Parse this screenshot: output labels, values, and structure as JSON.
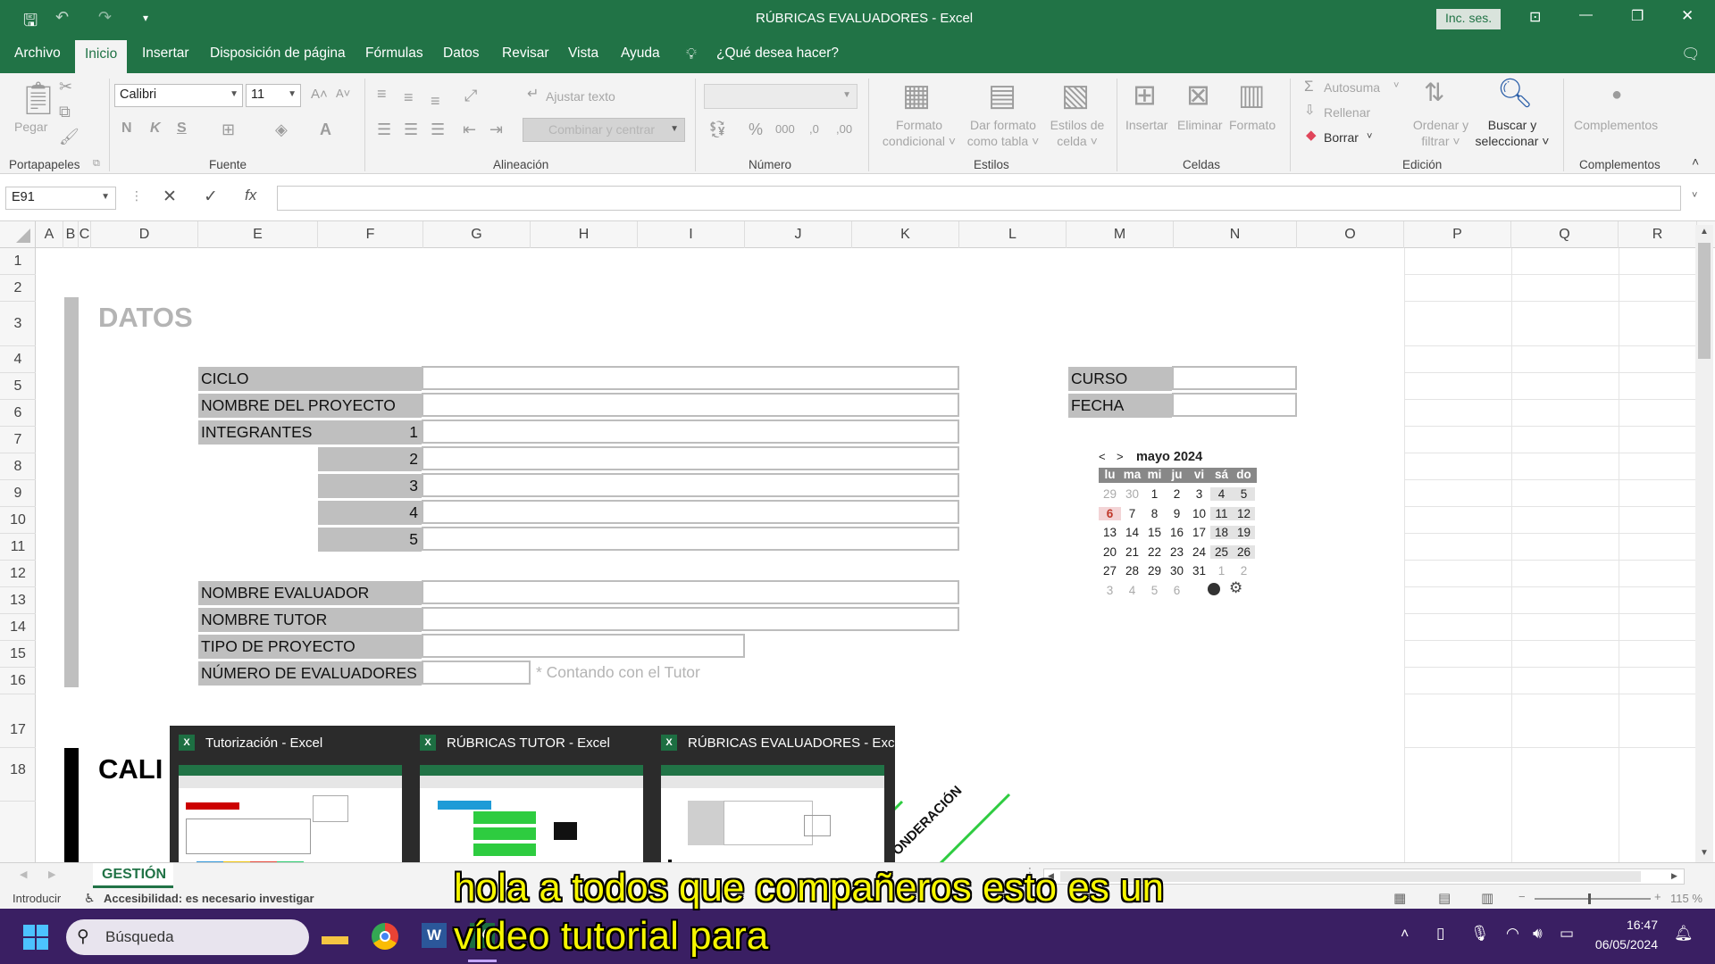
{
  "window": {
    "title": "RÚBRICAS EVALUADORES  -  Excel",
    "signin_label": "Inc. ses.",
    "minimize_glyph": "—",
    "restore_glyph": "❐",
    "close_glyph": "✕"
  },
  "menu": {
    "tabs": [
      "Archivo",
      "Inicio",
      "Insertar",
      "Disposición de página",
      "Fórmulas",
      "Datos",
      "Revisar",
      "Vista",
      "Ayuda"
    ],
    "active": "Inicio",
    "tell_me": "¿Qué desea hacer?"
  },
  "ribbon": {
    "clipboard": {
      "paste": "Pegar",
      "label": "Portapapeles"
    },
    "font": {
      "name": "Calibri",
      "size": "11",
      "bold": "N",
      "italic": "K",
      "underline": "S",
      "label": "Fuente"
    },
    "alignment": {
      "wrap": "Ajustar texto",
      "merge": "Combinar y centrar",
      "label": "Alineación"
    },
    "number": {
      "label": "Número",
      "percent": "%",
      "thousands": "000"
    },
    "styles": {
      "conditional": [
        "Formato",
        "condicional"
      ],
      "table": [
        "Dar formato",
        "como tabla"
      ],
      "cell": [
        "Estilos de",
        "celda"
      ],
      "label": "Estilos"
    },
    "cells": {
      "insert": "Insertar",
      "delete": "Eliminar",
      "format": "Formato",
      "label": "Celdas"
    },
    "editing": {
      "autosum": "Autosuma",
      "fill": "Rellenar",
      "clear": "Borrar",
      "sort": [
        "Ordenar y",
        "filtrar"
      ],
      "find": [
        "Buscar y",
        "seleccionar"
      ],
      "label": "Edición"
    },
    "addins": {
      "button": "Complementos",
      "label": "Complementos"
    }
  },
  "formula_bar": {
    "name_box": "E91",
    "fx": "fx",
    "value": ""
  },
  "columns": [
    "A",
    "B",
    "C",
    "D",
    "E",
    "F",
    "G",
    "H",
    "I",
    "J",
    "K",
    "L",
    "M",
    "N",
    "O",
    "P",
    "Q",
    "R"
  ],
  "rows": [
    "1",
    "2",
    "3",
    "4",
    "5",
    "6",
    "7",
    "8",
    "9",
    "10",
    "11",
    "12",
    "13",
    "14",
    "15",
    "16",
    "17",
    "18"
  ],
  "sheet": {
    "datos_title": "DATOS",
    "labels": {
      "ciclo": "CICLO",
      "proyecto": "NOMBRE DEL PROYECTO",
      "integrantes": "INTEGRANTES",
      "n1": "1",
      "n2": "2",
      "n3": "3",
      "n4": "4",
      "n5": "5",
      "evaluador": "NOMBRE EVALUADOR",
      "tutor": "NOMBRE TUTOR",
      "tipo": "TIPO DE PROYECTO",
      "num_eval": "NÚMERO DE EVALUADORES",
      "curso": "CURSO",
      "fecha": "FECHA"
    },
    "note": "* Contando con el Tutor",
    "cali_title": "CALI",
    "ponderacion": "PONDERACIÓN"
  },
  "calendar": {
    "prev": "<",
    "next": ">",
    "month": "mayo 2024",
    "weekdays": [
      "lu",
      "ma",
      "mi",
      "ju",
      "vi",
      "sá",
      "do"
    ],
    "weeks": [
      [
        "29",
        "30",
        "1",
        "2",
        "3",
        "4",
        "5"
      ],
      [
        "6",
        "7",
        "8",
        "9",
        "10",
        "11",
        "12"
      ],
      [
        "13",
        "14",
        "15",
        "16",
        "17",
        "18",
        "19"
      ],
      [
        "20",
        "21",
        "22",
        "23",
        "24",
        "25",
        "26"
      ],
      [
        "27",
        "28",
        "29",
        "30",
        "31",
        "1",
        "2"
      ],
      [
        "3",
        "4",
        "5",
        "6"
      ]
    ],
    "today": "6",
    "today_color": "#c0392b"
  },
  "task_previews": [
    {
      "title": "Tutorización - Excel"
    },
    {
      "title": "RÚBRICAS TUTOR - Excel"
    },
    {
      "title": "RÚBRICAS EVALUADORES - Excel"
    }
  ],
  "sheet_tab": "GESTIÓN",
  "status": {
    "mode": "Introducir",
    "accessibility": "Accesibilidad: es necesario investigar",
    "zoom": "115 %"
  },
  "taskbar": {
    "search": "Búsqueda",
    "time": "16:47",
    "date": "06/05/2024"
  },
  "subtitles": {
    "line1": "hola a todos que compañeros esto es un",
    "line2": "vídeo tutorial para"
  },
  "colors": {
    "excel_green": "#217346",
    "label_gray": "#bfbfbf",
    "subtitle_yellow": "#f6f600",
    "taskbar_purple": "#3a1f63"
  }
}
